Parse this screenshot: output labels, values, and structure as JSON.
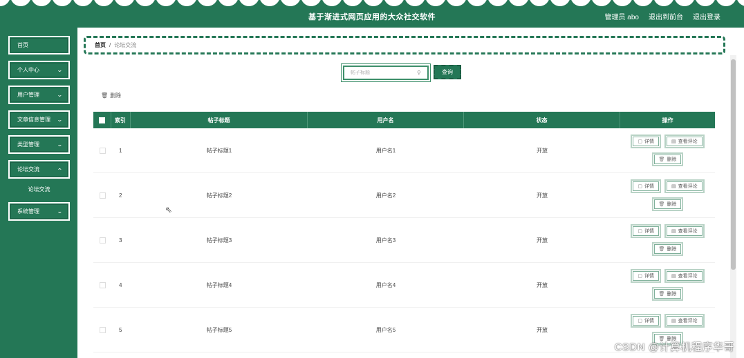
{
  "header": {
    "title": "基于渐进式网页应用的大众社交软件",
    "user_label": "管理员 abo",
    "back_label": "退出到前台",
    "logout_label": "退出登录",
    "color": "#247756"
  },
  "sidebar": {
    "items": [
      {
        "label": "首页",
        "has_chevron": false
      },
      {
        "label": "个人中心",
        "has_chevron": true
      },
      {
        "label": "用户管理",
        "has_chevron": true
      },
      {
        "label": "文章信息管理",
        "has_chevron": true
      },
      {
        "label": "类型管理",
        "has_chevron": true
      },
      {
        "label": "论坛交流",
        "has_chevron": true
      },
      {
        "label": "论坛交流",
        "is_sub": true
      },
      {
        "label": "系统管理",
        "has_chevron": true
      }
    ]
  },
  "breadcrumb": {
    "home": "首页",
    "separator": "/",
    "current": "论坛交流"
  },
  "search": {
    "placeholder": "帖子标题",
    "button_label": "查询"
  },
  "toolbar": {
    "delete_label": "删除"
  },
  "table": {
    "headers": {
      "index": "索引",
      "title": "帖子标题",
      "username": "用户名",
      "status": "状态",
      "actions": "操作"
    },
    "rows": [
      {
        "index": "1",
        "title": "帖子标题1",
        "username": "用户名1",
        "status": "开放"
      },
      {
        "index": "2",
        "title": "帖子标题2",
        "username": "用户名2",
        "status": "开放"
      },
      {
        "index": "3",
        "title": "帖子标题3",
        "username": "用户名3",
        "status": "开放"
      },
      {
        "index": "4",
        "title": "帖子标题4",
        "username": "用户名4",
        "status": "开放"
      },
      {
        "index": "5",
        "title": "帖子标题5",
        "username": "用户名5",
        "status": "开放"
      }
    ],
    "actions": {
      "detail": "详情",
      "view_comments": "查看评论",
      "delete": "删除"
    }
  },
  "watermark": "CSDN @计算机程序华哥"
}
